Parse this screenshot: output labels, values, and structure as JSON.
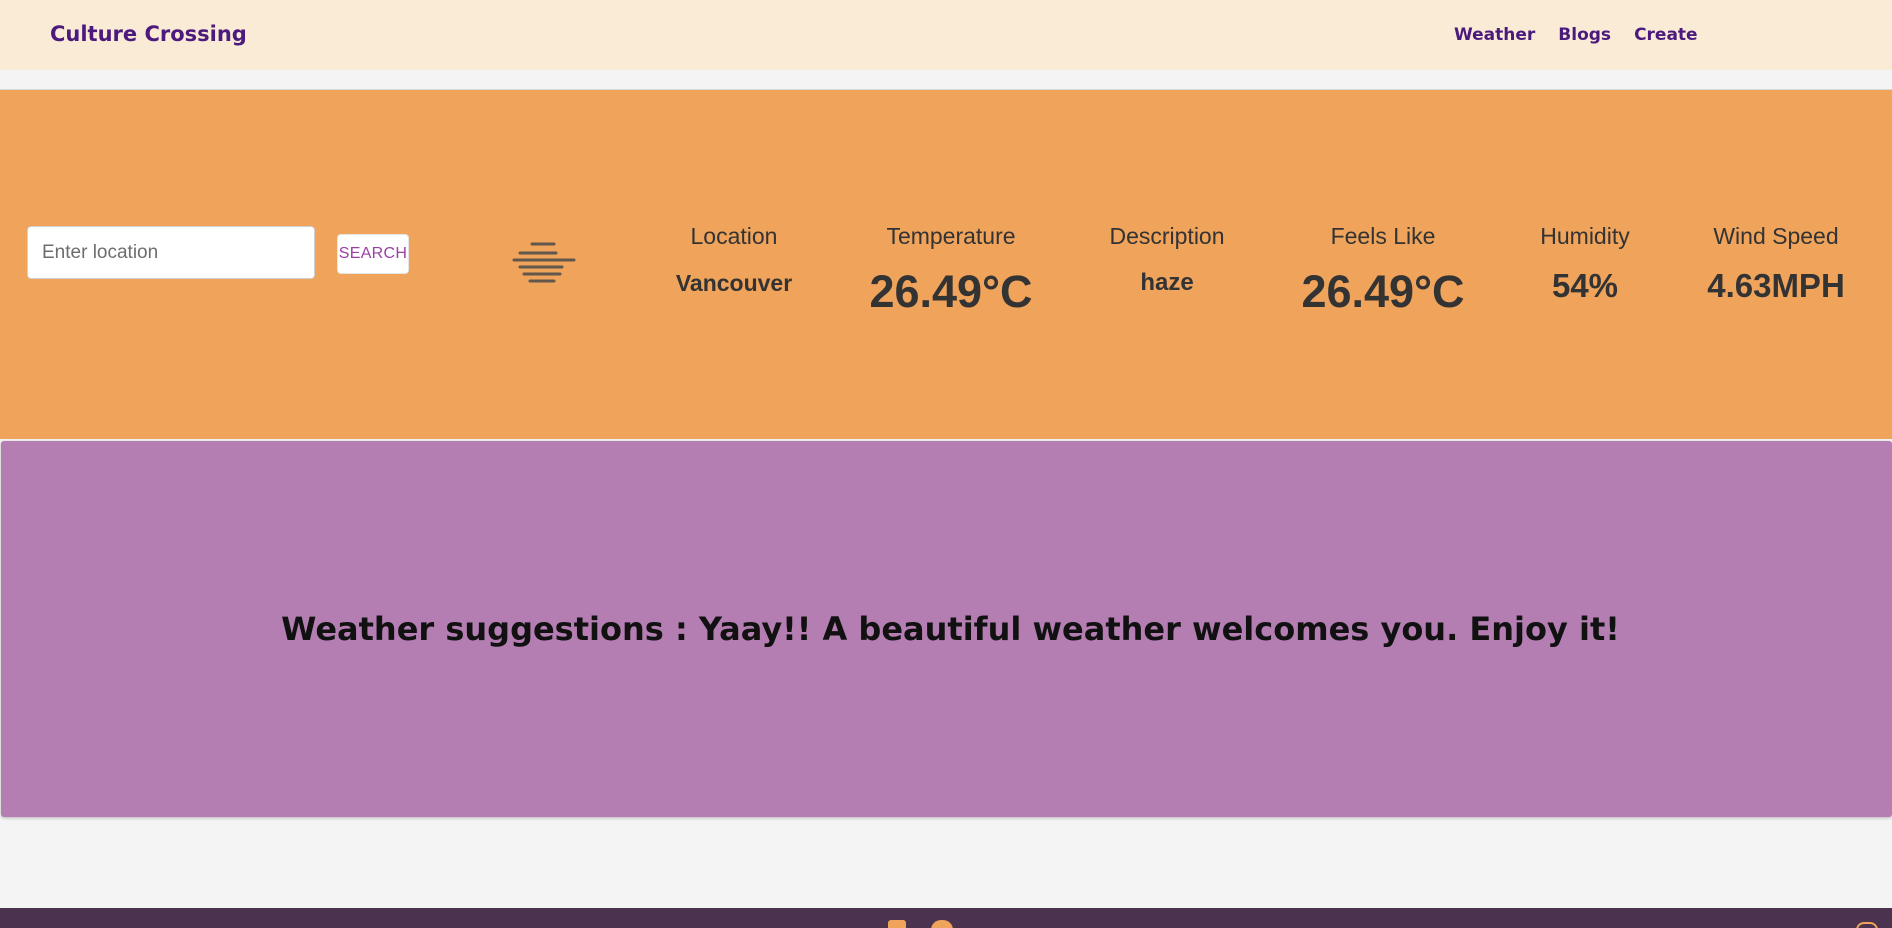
{
  "navbar": {
    "brand": "Culture Crossing",
    "links": [
      "Weather",
      "Blogs",
      "Create"
    ]
  },
  "search": {
    "placeholder": "Enter location",
    "button_label": "SEARCH"
  },
  "weather": {
    "icon": "haze-icon",
    "stats": [
      {
        "label": "Location",
        "value": "Vancouver"
      },
      {
        "label": "Temperature",
        "value": "26.49°C"
      },
      {
        "label": "Description",
        "value": "haze"
      },
      {
        "label": "Feels Like",
        "value": "26.49°C"
      },
      {
        "label": "Humidity",
        "value": "54%"
      },
      {
        "label": "Wind Speed",
        "value": "4.63MPH"
      }
    ]
  },
  "suggestion": {
    "text": "Weather suggestions : Yaay!! A beautiful weather welcomes you. Enjoy it!"
  },
  "footer": {
    "icons": [
      "linkedin-icon",
      "github-icon",
      "help-icon"
    ]
  },
  "colors": {
    "navbar_bg": "#faebd7",
    "brand": "#4b1a7c",
    "weather_bg": "#efa35b",
    "suggestion_bg": "#b57eb3",
    "footer_bg": "#4b3350"
  }
}
